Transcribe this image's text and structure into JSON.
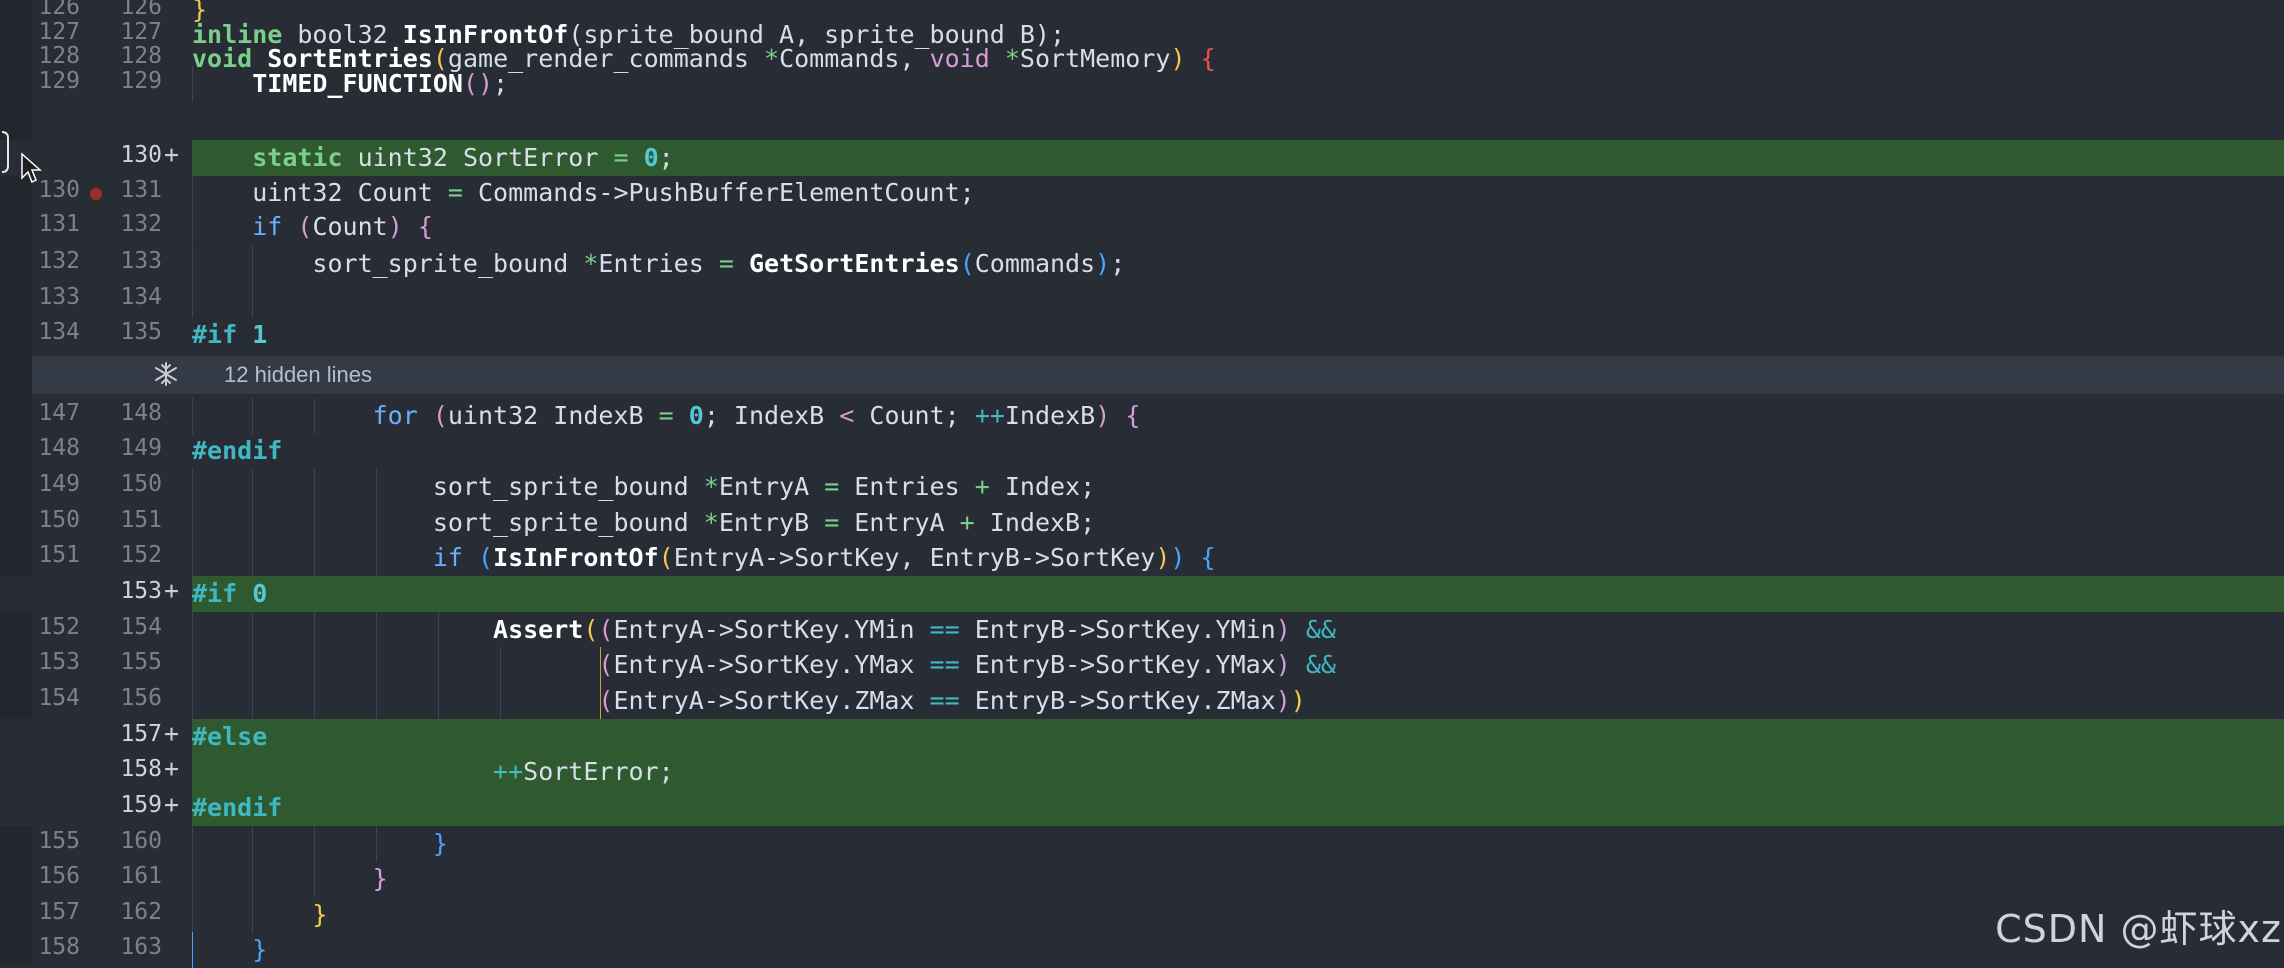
{
  "hidden_lines_label": "12 hidden lines",
  "watermark": "CSDN @虾球xz",
  "rows": [
    {
      "old": "126",
      "new": "126",
      "added": false
    },
    {
      "old": "127",
      "new": "127",
      "added": false
    },
    {
      "old": "128",
      "new": "128",
      "added": false
    },
    {
      "old": "129",
      "new": "129",
      "added": false
    },
    {
      "old": "",
      "new": "130",
      "added": true
    },
    {
      "old": "130",
      "new": "131",
      "added": false,
      "breakpoint": true
    },
    {
      "old": "131",
      "new": "132",
      "added": false
    },
    {
      "old": "132",
      "new": "133",
      "added": false
    },
    {
      "old": "133",
      "new": "134",
      "added": false
    },
    {
      "old": "134",
      "new": "135",
      "added": false
    },
    {
      "old": "147",
      "new": "148",
      "added": false
    },
    {
      "old": "148",
      "new": "149",
      "added": false
    },
    {
      "old": "149",
      "new": "150",
      "added": false
    },
    {
      "old": "150",
      "new": "151",
      "added": false
    },
    {
      "old": "151",
      "new": "152",
      "added": false
    },
    {
      "old": "",
      "new": "153",
      "added": true
    },
    {
      "old": "152",
      "new": "154",
      "added": false
    },
    {
      "old": "153",
      "new": "155",
      "added": false
    },
    {
      "old": "154",
      "new": "156",
      "added": false
    },
    {
      "old": "",
      "new": "157",
      "added": true
    },
    {
      "old": "",
      "new": "158",
      "added": true
    },
    {
      "old": "",
      "new": "159",
      "added": true
    },
    {
      "old": "155",
      "new": "160",
      "added": false
    },
    {
      "old": "156",
      "new": "161",
      "added": false
    },
    {
      "old": "157",
      "new": "162",
      "added": false
    },
    {
      "old": "158",
      "new": "163",
      "added": false
    }
  ],
  "code": {
    "l0": "}",
    "l1_a": "inline",
    "l1_b": " bool32 ",
    "l1_c": "IsInFrontOf",
    "l1_d": "(sprite_bound A, sprite_bound B);",
    "l2_a": "void",
    "l2_b": " ",
    "l2_c": "SortEntries",
    "l2_d": "game_render_commands ",
    "l2_e": "*",
    "l2_f": "Commands, ",
    "l2_g": "void",
    "l2_h": " ",
    "l2_i": "*",
    "l2_j": "SortMemory",
    "l3_a": "TIMED_FUNCTION",
    "l3_b": ";",
    "l4_a": "static",
    "l4_b": " uint32 SortError ",
    "l4_c": "=",
    "l4_d": " ",
    "l4_e": "0",
    "l4_f": ";",
    "l5_a": "uint32 Count ",
    "l5_b": "=",
    "l5_c": " Commands->PushBufferElementCount;",
    "l6_a": "if",
    "l6_b": " ",
    "l6_c": "Count",
    "l7_a": "sort_sprite_bound ",
    "l7_b": "*",
    "l7_c": "Entries ",
    "l7_d": "=",
    "l7_e": " ",
    "l7_f": "GetSortEntries",
    "l7_g": "Commands",
    "l7_h": ";",
    "l9_a": "#if",
    "l9_b": " ",
    "l9_c": "1",
    "l10_a": "for",
    "l10_b": " ",
    "l10_c": "uint32 IndexB ",
    "l10_d": "=",
    "l10_e": " ",
    "l10_f": "0",
    "l10_g": "; IndexB ",
    "l10_h": "<",
    "l10_i": " Count; ",
    "l10_j": "++",
    "l10_k": "IndexB",
    "l11": "#endif",
    "l12_a": "sort_sprite_bound ",
    "l12_b": "*",
    "l12_c": "EntryA ",
    "l12_d": "=",
    "l12_e": " Entries ",
    "l12_f": "+",
    "l12_g": " Index;",
    "l13_a": "sort_sprite_bound ",
    "l13_b": "*",
    "l13_c": "EntryB ",
    "l13_d": "=",
    "l13_e": " EntryA ",
    "l13_f": "+",
    "l13_g": " IndexB;",
    "l14_a": "if",
    "l14_b": " ",
    "l14_c": "IsInFrontOf",
    "l14_d": "EntryA->SortKey, EntryB->SortKey",
    "l15_a": "#if",
    "l15_b": " ",
    "l15_c": "0",
    "l16_a": "Assert",
    "l16_b": "EntryA->SortKey.YMin ",
    "l16_c": "==",
    "l16_d": " EntryB->SortKey.YMin",
    "l16_e": "&&",
    "l17_a": "EntryA->SortKey.YMax ",
    "l17_b": "==",
    "l17_c": " EntryB->SortKey.YMax",
    "l17_d": "&&",
    "l18_a": "EntryA->SortKey.ZMax ",
    "l18_b": "==",
    "l18_c": " EntryB->SortKey.ZMax",
    "l19": "#else",
    "l20_a": "++",
    "l20_b": "SortError;",
    "l21": "#endif"
  }
}
